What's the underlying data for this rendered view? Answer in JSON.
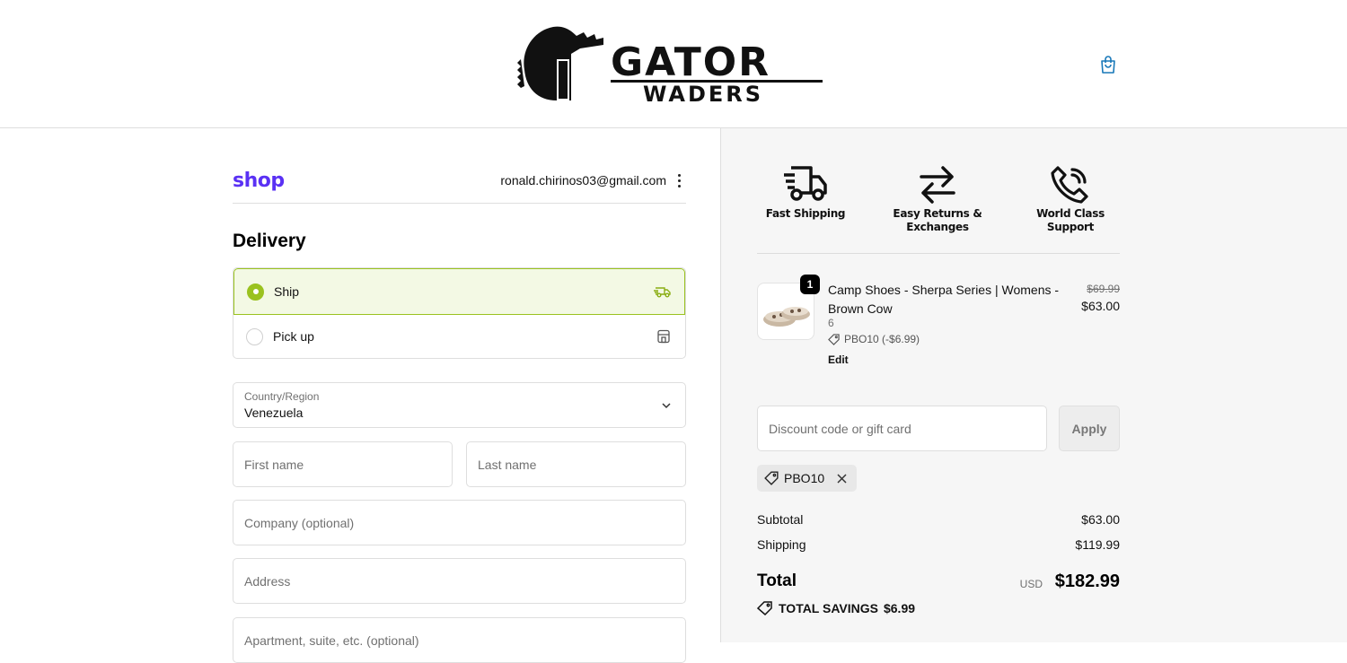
{
  "header": {
    "logo_text_top": "GATOR",
    "logo_text_bottom": "WADERS",
    "cart_icon": "shopping-bag-icon"
  },
  "account": {
    "shop_logo": "shop",
    "email": "ronald.chirinos03@gmail.com"
  },
  "delivery": {
    "title": "Delivery",
    "options": [
      {
        "label": "Ship",
        "selected": true,
        "icon": "truck-icon"
      },
      {
        "label": "Pick up",
        "selected": false,
        "icon": "store-icon"
      }
    ]
  },
  "form": {
    "country_label": "Country/Region",
    "country_value": "Venezuela",
    "first_name_placeholder": "First name",
    "last_name_placeholder": "Last name",
    "company_placeholder": "Company (optional)",
    "address_placeholder": "Address",
    "apartment_placeholder": "Apartment, suite, etc. (optional)"
  },
  "badges": [
    {
      "label_1": "Fast Shipping",
      "label_2": "",
      "icon": "delivery-truck-icon"
    },
    {
      "label_1": "Easy Returns &",
      "label_2": "Exchanges",
      "icon": "arrows-exchange-icon"
    },
    {
      "label_1": "World Class",
      "label_2": "Support",
      "icon": "phone-icon"
    }
  ],
  "cart_item": {
    "quantity": "1",
    "name": "Camp Shoes - Sherpa Series | Womens - Brown Cow",
    "variant": "6",
    "discount": "PBO10 (-$6.99)",
    "edit_label": "Edit",
    "original_price": "$69.99",
    "price": "$63.00"
  },
  "discount": {
    "placeholder": "Discount code or gift card",
    "apply_label": "Apply",
    "applied_code": "PBO10"
  },
  "summary": {
    "subtotal_label": "Subtotal",
    "subtotal_value": "$63.00",
    "shipping_label": "Shipping",
    "shipping_value": "$119.99",
    "total_label": "Total",
    "currency": "USD",
    "total_value": "$182.99",
    "savings_label": "TOTAL SAVINGS",
    "savings_value": "$6.99"
  },
  "colors": {
    "accent": "#9ac21f",
    "shop_purple": "#5a31f4"
  }
}
